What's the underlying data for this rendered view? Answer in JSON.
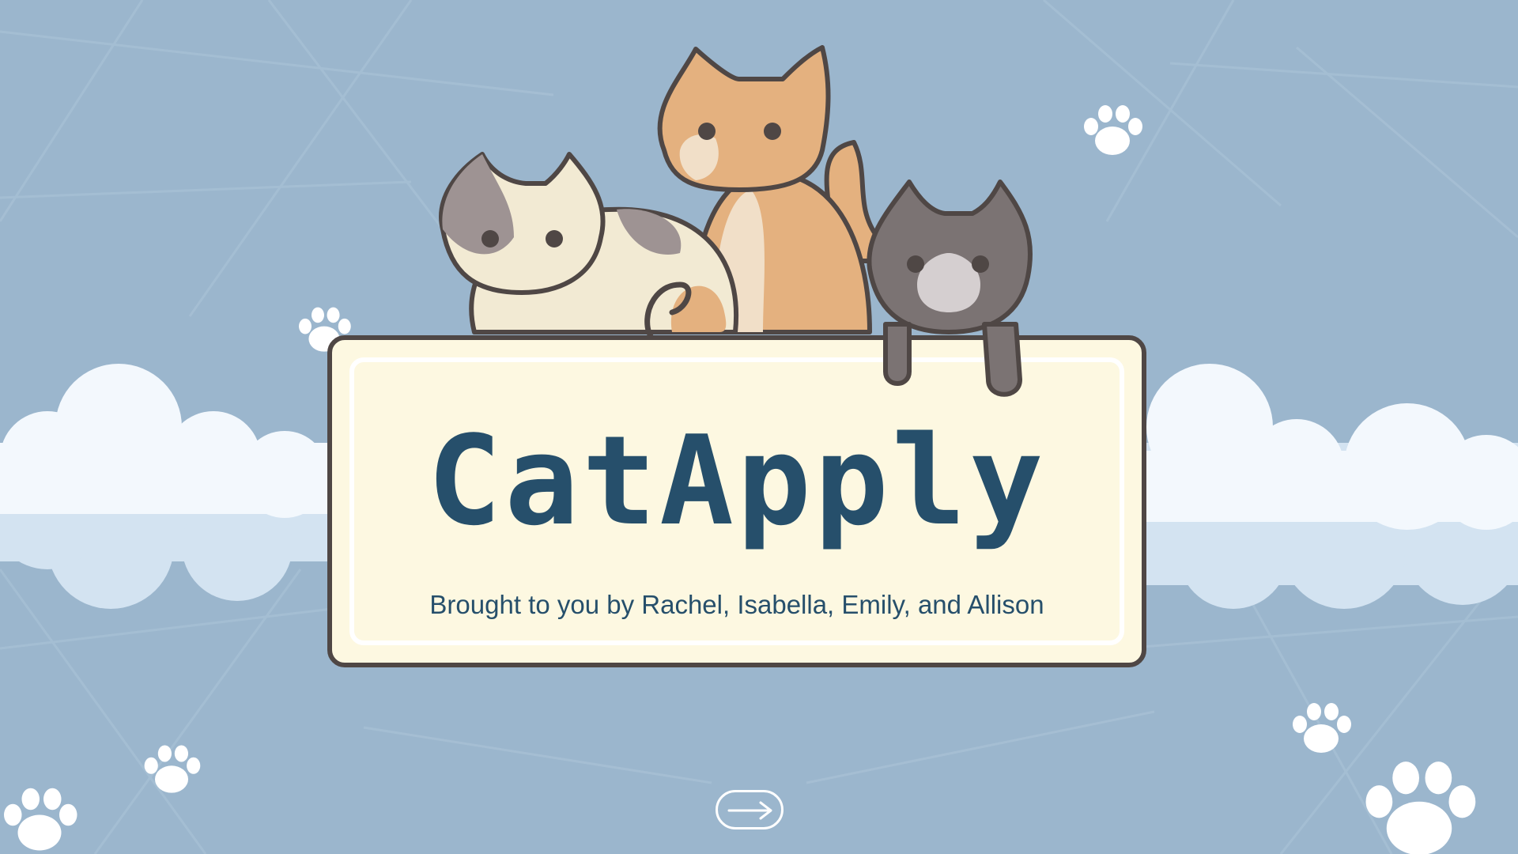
{
  "slide": {
    "title": "CatApply",
    "subtitle": "Brought to you by Rachel, Isabella, Emily, and Allison",
    "next_icon": "arrow-right-icon"
  },
  "colors": {
    "background": "#9bb6cd",
    "card_fill": "#fdf8e1",
    "card_border": "#4f4745",
    "title_text": "#264f6b",
    "cloud_front": "#f3f8fd",
    "cloud_back": "#d3e3f1",
    "paw": "#ffffff"
  },
  "decorations": {
    "cats": [
      "calico-cat",
      "orange-tabby-cat",
      "gray-cat"
    ],
    "paw_icon": "paw-print-icon",
    "cloud_icon": "cloud-icon"
  }
}
